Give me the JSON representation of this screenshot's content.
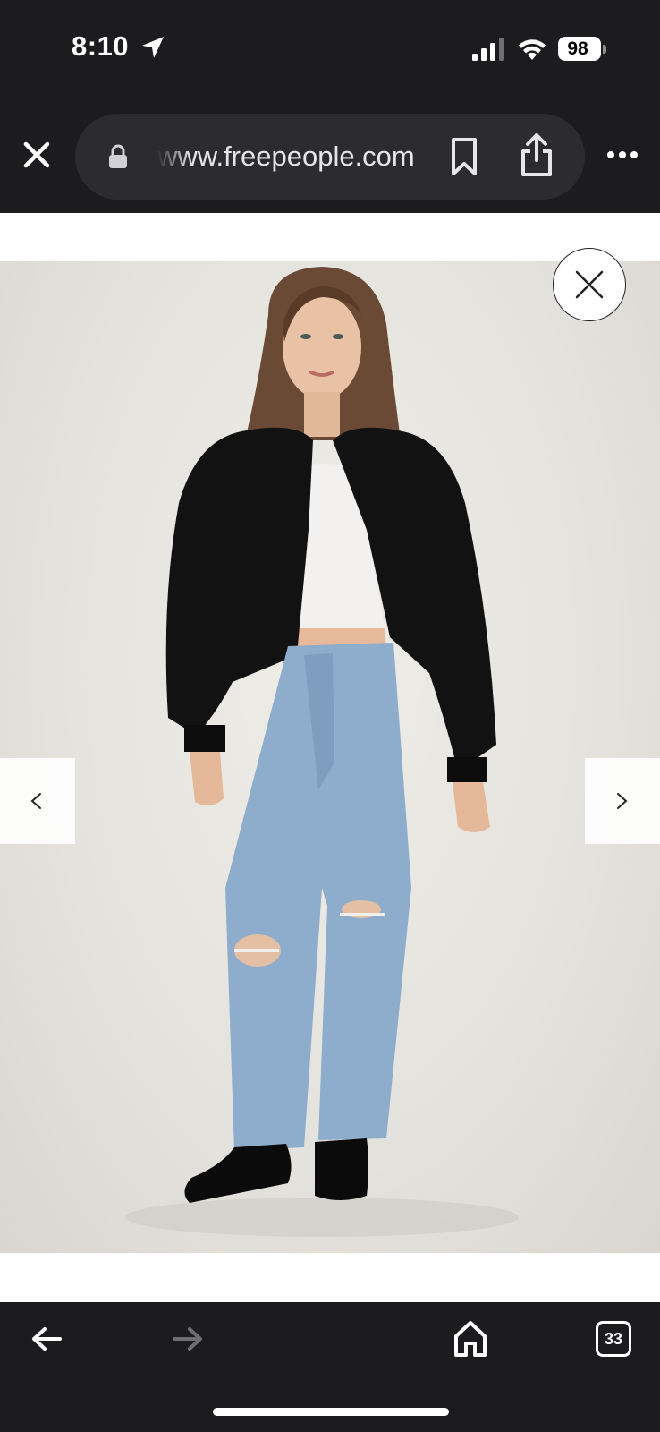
{
  "status_bar": {
    "time": "8:10",
    "battery": "98"
  },
  "browser": {
    "url": "www.freepeople.com",
    "tab_count": "33"
  },
  "gallery": {
    "prev_label": "<",
    "next_label": ">"
  },
  "colors": {
    "chrome": "#1c1c1e",
    "url_pill": "#2c2c2e",
    "page_bg": "#ffffff"
  },
  "icons": [
    "location-arrow-icon",
    "signal-icon",
    "wifi-icon",
    "close-tab-icon",
    "lock-icon",
    "bookmark-icon",
    "share-icon",
    "more-icon",
    "close-icon",
    "chevron-left-icon",
    "chevron-right-icon",
    "back-arrow-icon",
    "forward-arrow-icon",
    "home-icon",
    "tabs-icon"
  ]
}
